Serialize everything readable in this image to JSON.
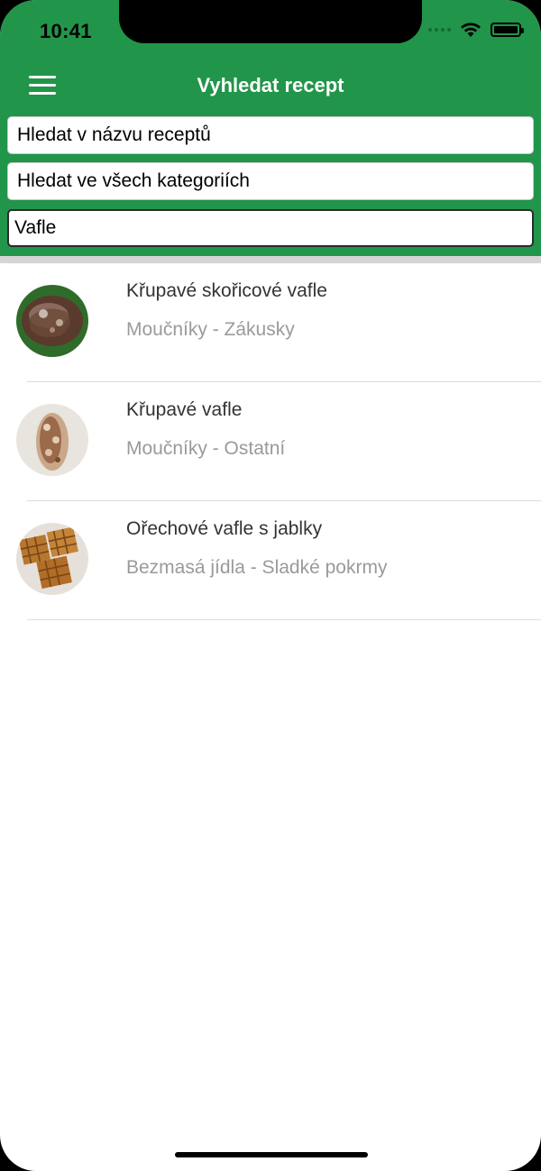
{
  "status_bar": {
    "time": "10:41"
  },
  "header": {
    "title": "Vyhledat recept",
    "menu_icon": "hamburger-menu-icon",
    "color": "#21954a"
  },
  "search": {
    "name_scope": "Hledat v názvu receptů",
    "category_scope": "Hledat ve všech kategoriích",
    "query": "Vafle"
  },
  "results": [
    {
      "title": "Křupavé skořicové vafle",
      "subtitle": "Moučníky - Zákusky"
    },
    {
      "title": "Křupavé vafle",
      "subtitle": "Moučníky - Ostatní"
    },
    {
      "title": "Ořechové vafle s jablky",
      "subtitle": "Bezmasá jídla - Sladké pokrmy"
    }
  ]
}
